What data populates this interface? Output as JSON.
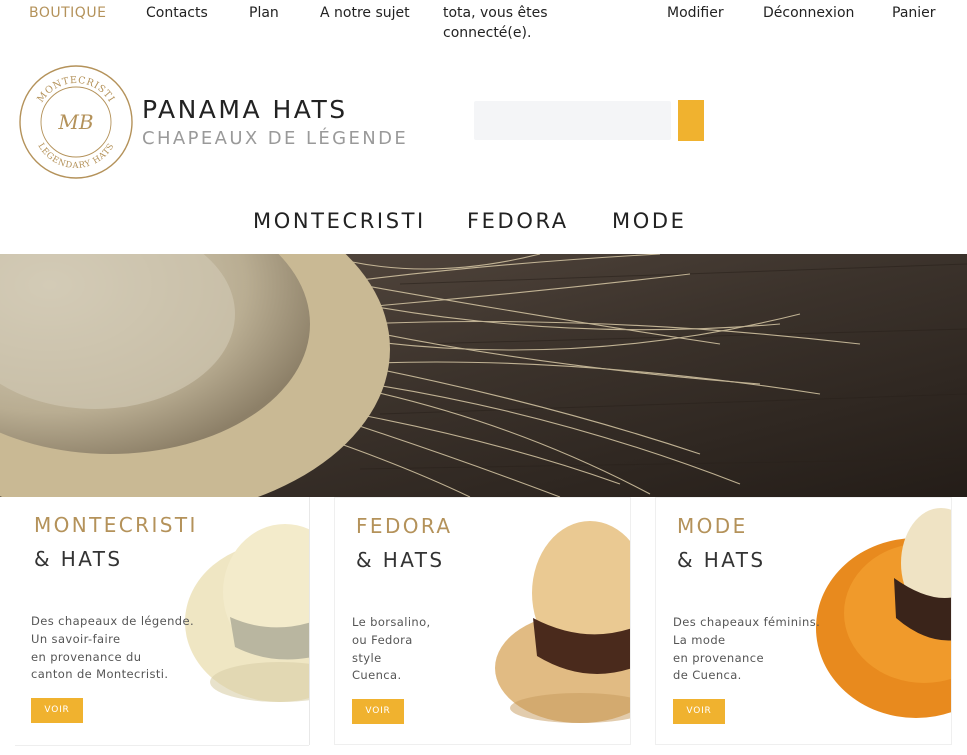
{
  "topnav": {
    "items": [
      "BOUTIQUE",
      "Contacts",
      "Plan",
      "A notre sujet",
      "tota, vous êtes connecté(e).",
      "Modifier",
      "Déconnexion",
      "Panier"
    ]
  },
  "header": {
    "logo_text_top": "MONTECRISTI",
    "logo_text_bottom": "LEGENDARY HATS",
    "logo_monogram": "MB",
    "title": "PANAMA HATS",
    "subtitle": "CHAPEAUX DE LÉGENDE",
    "search_placeholder": ""
  },
  "mainnav": {
    "items": [
      "MONTECRISTI",
      "FEDORA",
      "MODE"
    ]
  },
  "cards": [
    {
      "title": "MONTECRISTI",
      "subtitle": "& HATS",
      "desc": [
        "Des chapeaux de légende.",
        "Un savoir-faire",
        "en provenance du",
        "canton de Montecristi."
      ],
      "button": "VOIR"
    },
    {
      "title": "FEDORA",
      "subtitle": "& HATS",
      "desc": [
        "Le borsalino,",
        "ou Fedora",
        "style",
        "Cuenca."
      ],
      "button": "VOIR"
    },
    {
      "title": "MODE",
      "subtitle": "& HATS",
      "desc": [
        "Des chapeaux féminins.",
        "La mode",
        "en provenance",
        "de Cuenca."
      ],
      "button": "VOIR"
    }
  ],
  "colors": {
    "accent": "#b4925a",
    "button": "#f0b22f"
  }
}
